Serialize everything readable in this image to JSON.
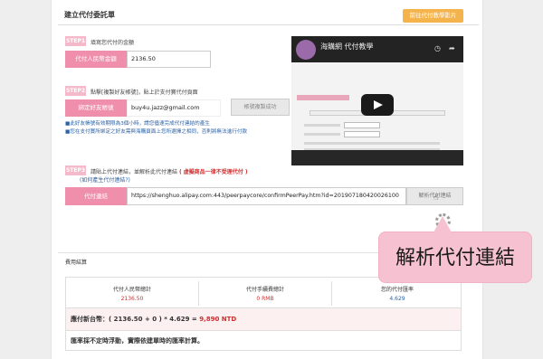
{
  "page": {
    "title": "建立代付委託單",
    "video_button": "前往代付教學影片"
  },
  "step1": {
    "badge": "STEP1",
    "desc": "填寫您代付的金額",
    "label": "代付人民幣金額",
    "value": "2136.50"
  },
  "step2": {
    "badge": "STEP2",
    "desc": "點擊[複製好友帳號]，貼上於支付寶代付頁面",
    "label": "綁定好友帳號",
    "value": "buy4u.jazz@gmail.com",
    "copy_button": "帳號複製成功",
    "note1": "■此好友帳號有效期限為3個小時，請您儘速完成代付連結的產生",
    "note2": "■您在支付寶所綁定之好友需與海購頁面上您所選擇之相同，否則將無法進行付款"
  },
  "step3": {
    "badge": "STEP3",
    "desc": "請貼上代付連結，並解析此代付連結",
    "desc_warning": "( 虛擬商品一律不受理代付 )",
    "help_link": "(如何產生代付連結?)",
    "label": "代付連結",
    "value": "https://shenghuo.alipay.com:443/peerpaycore/confirmPeerPay.htm?id=201907180420026100",
    "parse_button": "解析代付連結"
  },
  "video": {
    "channel_title": "海購網 代付教學",
    "icon": "play-icon"
  },
  "summary": {
    "section_title": "費用結算",
    "col1_head": "代付人民幣總計",
    "col1_val": "2136.50",
    "col2_head": "代付手續費總計",
    "col2_val": "0 RMB",
    "col3_head": "您的代付匯率",
    "col3_val": "4.629",
    "pay_formula": "應付新台幣：( 2136.50 + 0 ) * 4.629 = ",
    "pay_total": "9,890 NTD",
    "rate_note": "匯率採不定時浮動，實際依建單時的匯率計算。"
  },
  "callout": {
    "text": "解析代付連結"
  },
  "colors": {
    "pink": "#f08fab",
    "orange": "#f5b34c",
    "link_blue": "#2c62a8",
    "red": "#d32f2f"
  }
}
